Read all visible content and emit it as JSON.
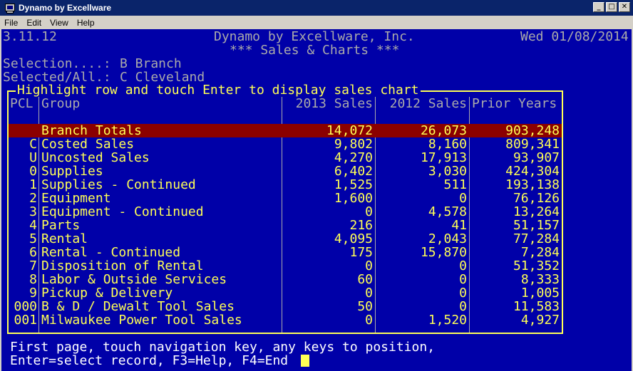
{
  "window": {
    "title": "Dynamo by Excellware"
  },
  "menu": [
    "File",
    "Edit",
    "View",
    "Help"
  ],
  "header": {
    "version": "3.11.12",
    "company": "Dynamo by Excellware, Inc.",
    "date": "Wed 01/08/2014",
    "subtitle": "*** Sales & Charts ***"
  },
  "selection": {
    "selection_label": "Selection....:",
    "selection_value": "B Branch",
    "selected_label": "Selected/All.:",
    "selected_value": "C Cleveland"
  },
  "box_title": "Highlight row and touch Enter to display sales chart",
  "columns": {
    "pcl": "PCL",
    "group": "Group",
    "s2013": "2013 Sales",
    "s2012": "2012 Sales",
    "prior": "Prior Years"
  },
  "rows": [
    {
      "pcl": "",
      "group": "Branch Totals",
      "s2013": "14,072",
      "s2012": "26,073",
      "prior": "903,248"
    },
    {
      "pcl": "C",
      "group": "Costed Sales",
      "s2013": "9,802",
      "s2012": "8,160",
      "prior": "809,341"
    },
    {
      "pcl": "U",
      "group": "Uncosted Sales",
      "s2013": "4,270",
      "s2012": "17,913",
      "prior": "93,907"
    },
    {
      "pcl": "0",
      "group": "Supplies",
      "s2013": "6,402",
      "s2012": "3,030",
      "prior": "424,304"
    },
    {
      "pcl": "1",
      "group": "Supplies - Continued",
      "s2013": "1,525",
      "s2012": "511",
      "prior": "193,138"
    },
    {
      "pcl": "2",
      "group": "Equipment",
      "s2013": "1,600",
      "s2012": "0",
      "prior": "76,126"
    },
    {
      "pcl": "3",
      "group": "Equipment - Continued",
      "s2013": "0",
      "s2012": "4,578",
      "prior": "13,264"
    },
    {
      "pcl": "4",
      "group": "Parts",
      "s2013": "216",
      "s2012": "41",
      "prior": "51,157"
    },
    {
      "pcl": "5",
      "group": "Rental",
      "s2013": "4,095",
      "s2012": "2,043",
      "prior": "77,284"
    },
    {
      "pcl": "6",
      "group": "Rental - Continued",
      "s2013": "175",
      "s2012": "15,870",
      "prior": "7,284"
    },
    {
      "pcl": "7",
      "group": "Disposition of Rental",
      "s2013": "0",
      "s2012": "0",
      "prior": "51,352"
    },
    {
      "pcl": "8",
      "group": "Labor & Outside Services",
      "s2013": "60",
      "s2012": "0",
      "prior": "8,333"
    },
    {
      "pcl": "9",
      "group": "Pickup & Delivery",
      "s2013": "0",
      "s2012": "0",
      "prior": "1,005"
    },
    {
      "pcl": "000",
      "group": "B & D / Dewalt Tool Sales",
      "s2013": "50",
      "s2012": "0",
      "prior": "11,583"
    },
    {
      "pcl": "001",
      "group": "Milwaukee Power Tool Sales",
      "s2013": "0",
      "s2012": "1,520",
      "prior": "4,927"
    }
  ],
  "status": {
    "line1": "First page, touch navigation key, any keys to position,",
    "line2": "Enter=select record, F3=Help, F4=End"
  },
  "colors": {
    "terminal_bg": "#0000a8",
    "highlight_row": "#8b0000",
    "accent_yellow": "#ffff55",
    "titlebar": "#0a246a"
  }
}
